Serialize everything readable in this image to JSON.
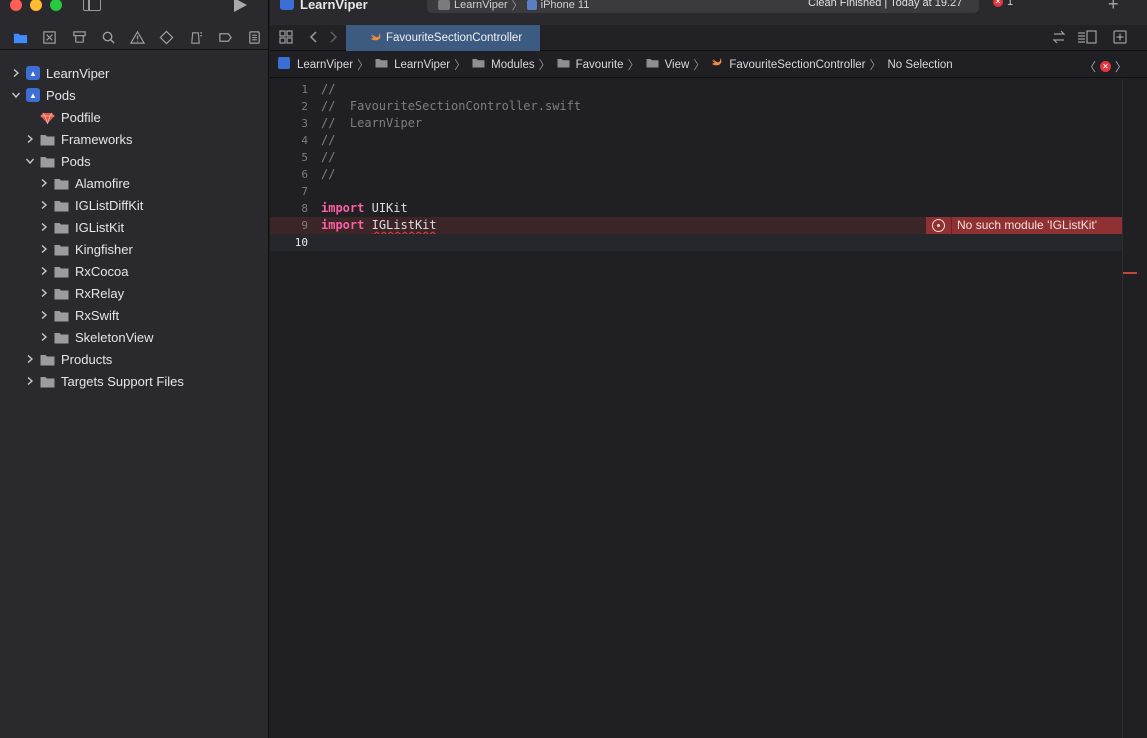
{
  "window": {
    "project_title": "LearnViper",
    "scheme": "LearnViper",
    "device": "iPhone 11",
    "status": "Clean Finished | Today at 19.27",
    "error_count": "1"
  },
  "colors": {
    "close": "#ff5f57",
    "minimize": "#febc2e",
    "zoom": "#28c840",
    "accent": "#3f8cff",
    "error": "#e0383e",
    "keyword": "#fc5fa3",
    "comment": "#7c7f84"
  },
  "navigator": {
    "icons": [
      "folder-icon",
      "source-control-icon",
      "symbol-icon",
      "search-icon",
      "warning-icon",
      "test-icon",
      "debug-icon",
      "breakpoint-icon",
      "report-icon"
    ],
    "items": [
      {
        "label": "LearnViper",
        "kind": "project",
        "level": 0,
        "expanded": false
      },
      {
        "label": "Pods",
        "kind": "project",
        "level": 0,
        "expanded": true
      },
      {
        "label": "Podfile",
        "kind": "ruby",
        "level": 1,
        "expanded": null
      },
      {
        "label": "Frameworks",
        "kind": "folder",
        "level": 1,
        "expanded": false
      },
      {
        "label": "Pods",
        "kind": "folder",
        "level": 1,
        "expanded": true
      },
      {
        "label": "Alamofire",
        "kind": "folder",
        "level": 2,
        "expanded": false
      },
      {
        "label": "IGListDiffKit",
        "kind": "folder",
        "level": 2,
        "expanded": false
      },
      {
        "label": "IGListKit",
        "kind": "folder",
        "level": 2,
        "expanded": false
      },
      {
        "label": "Kingfisher",
        "kind": "folder",
        "level": 2,
        "expanded": false
      },
      {
        "label": "RxCocoa",
        "kind": "folder",
        "level": 2,
        "expanded": false
      },
      {
        "label": "RxRelay",
        "kind": "folder",
        "level": 2,
        "expanded": false
      },
      {
        "label": "RxSwift",
        "kind": "folder",
        "level": 2,
        "expanded": false
      },
      {
        "label": "SkeletonView",
        "kind": "folder",
        "level": 2,
        "expanded": false
      },
      {
        "label": "Products",
        "kind": "folder",
        "level": 1,
        "expanded": false
      },
      {
        "label": "Targets Support Files",
        "kind": "folder",
        "level": 1,
        "expanded": false
      }
    ]
  },
  "tab": {
    "label": "FavouriteSectionController"
  },
  "jumpbar": {
    "crumbs": [
      "LearnViper",
      "LearnViper",
      "Modules",
      "Favourite",
      "View",
      "FavouriteSectionController",
      "No Selection"
    ]
  },
  "editor": {
    "lines": [
      {
        "n": "1",
        "text": "//"
      },
      {
        "n": "2",
        "text": "//  FavouriteSectionController.swift"
      },
      {
        "n": "3",
        "text": "//  LearnViper"
      },
      {
        "n": "4",
        "text": "//"
      },
      {
        "n": "5",
        "text": "//"
      },
      {
        "n": "6",
        "text": "//"
      },
      {
        "n": "7",
        "text": ""
      },
      {
        "n": "8",
        "keyword": "import",
        "ident": "UIKit"
      },
      {
        "n": "9",
        "keyword": "import",
        "ident": "IGListKit",
        "error": true
      },
      {
        "n": "10",
        "text": "",
        "current": true
      }
    ],
    "error_message": "No such module 'IGListKit'"
  }
}
